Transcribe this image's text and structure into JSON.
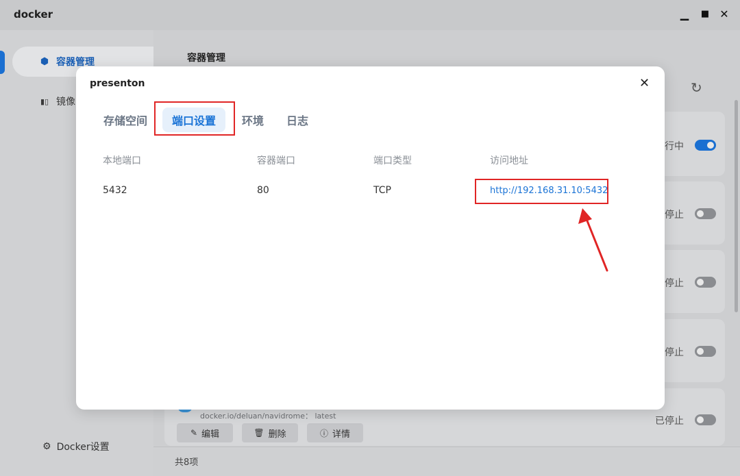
{
  "window": {
    "title": "docker",
    "minimize_glyph": "▁",
    "maximize_glyph": "■",
    "close_glyph": "✕"
  },
  "sidebar": {
    "items": [
      {
        "label": "容器管理",
        "icon": "hexagon-gear-icon",
        "glyph": "⬢"
      },
      {
        "label": "镜像",
        "icon": "book-icon",
        "glyph": "▮▯"
      }
    ],
    "docker_settings": {
      "label": "Docker设置",
      "glyph": "⚙"
    }
  },
  "main": {
    "title": "容器管理",
    "refresh_glyph": "↻",
    "containers": [
      {
        "status": "行中",
        "running": true
      },
      {
        "status": "停止",
        "running": false
      },
      {
        "status": "停止",
        "running": false
      },
      {
        "status": "停止",
        "running": false
      },
      {
        "status": "已停止",
        "running": false
      }
    ],
    "last_image": "docker.io/deluan/navidrome： latest",
    "actions": {
      "edit": {
        "label": "编辑",
        "glyph": "✎"
      },
      "delete": {
        "label": "删除",
        "glyph": "🗑"
      },
      "detail": {
        "label": "详情",
        "glyph": "ⓘ"
      }
    },
    "total": "共8项"
  },
  "modal": {
    "title": "presenton",
    "close_glyph": "✕",
    "tabs": [
      {
        "label": "存储空间",
        "active": false
      },
      {
        "label": "端口设置",
        "active": true
      },
      {
        "label": "环境",
        "active": false
      },
      {
        "label": "日志",
        "active": false
      }
    ],
    "table": {
      "headers": [
        "本地端口",
        "容器端口",
        "端口类型",
        "访问地址"
      ],
      "rows": [
        {
          "local_port": "5432",
          "container_port": "80",
          "type": "TCP",
          "url": "http://192.168.31.10:5432"
        }
      ]
    }
  },
  "colors": {
    "accent": "#1a73d6",
    "highlight": "#e02525"
  }
}
